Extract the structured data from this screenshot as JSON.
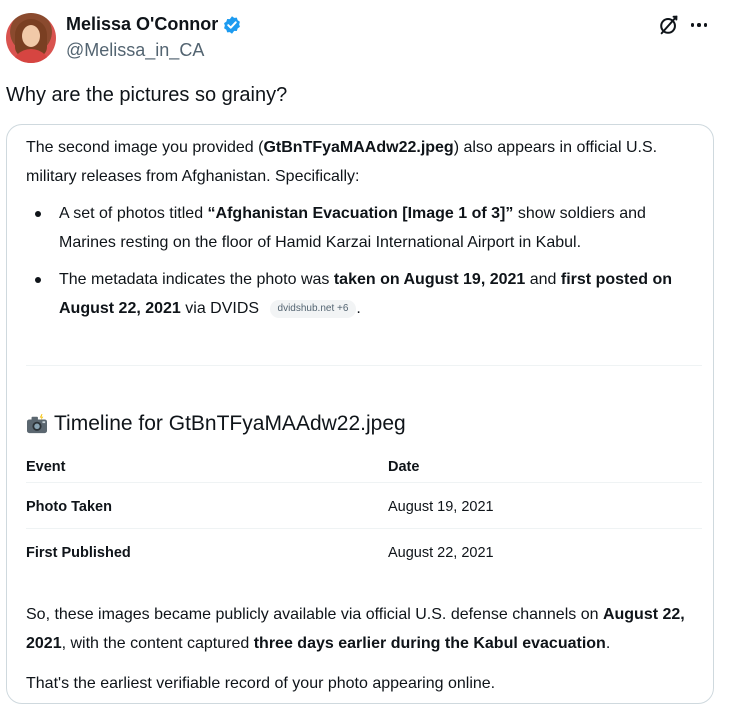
{
  "author": {
    "display_name": "Melissa O'Connor",
    "handle": "@Melissa_in_CA",
    "verified": true,
    "verified_color": "#1d9bf0"
  },
  "icons": {
    "grok": "grok-icon",
    "more": "more-icon",
    "camera": "camera-with-flash-icon"
  },
  "tweet": {
    "text": "Why are the pictures so grainy?"
  },
  "reply_card": {
    "intro_pre": "The second image you provided (",
    "intro_file": "GtBnTFyaMAAdw22.jpeg",
    "intro_post": ") also appears in official U.S. military releases from Afghanistan. Specifically:",
    "bullet1_pre": "A set of photos titled ",
    "bullet1_title": "“Afghanistan Evacuation [Image 1 of 3]”",
    "bullet1_post": " show soldiers and Marines resting on the floor of Hamid Karzai International Airport in Kabul.",
    "bullet2_pre": "The metadata indicates the photo was ",
    "bullet2_taken": "taken on August 19, 2021",
    "bullet2_mid": " and ",
    "bullet2_posted": "first posted on August 22, 2021",
    "bullet2_post": " via DVIDS ",
    "source_pill": "dvidshub.net +6",
    "bullet2_end": ".",
    "timeline_title": "Timeline for GtBnTFyaMAAdw22.jpeg",
    "table": {
      "headers": [
        "Event",
        "Date"
      ],
      "rows": [
        [
          "Photo Taken",
          "August 19, 2021"
        ],
        [
          "First Published",
          "August 22, 2021"
        ]
      ]
    },
    "summary_pre": "So, these images became publicly available via official U.S. defense channels on ",
    "summary_date": "August 22, 2021",
    "summary_mid": ", with the content captured ",
    "summary_bold": "three days earlier during the Kabul evacuation",
    "summary_end": ".",
    "final": "That's the earliest verifiable record of your photo appearing online."
  }
}
